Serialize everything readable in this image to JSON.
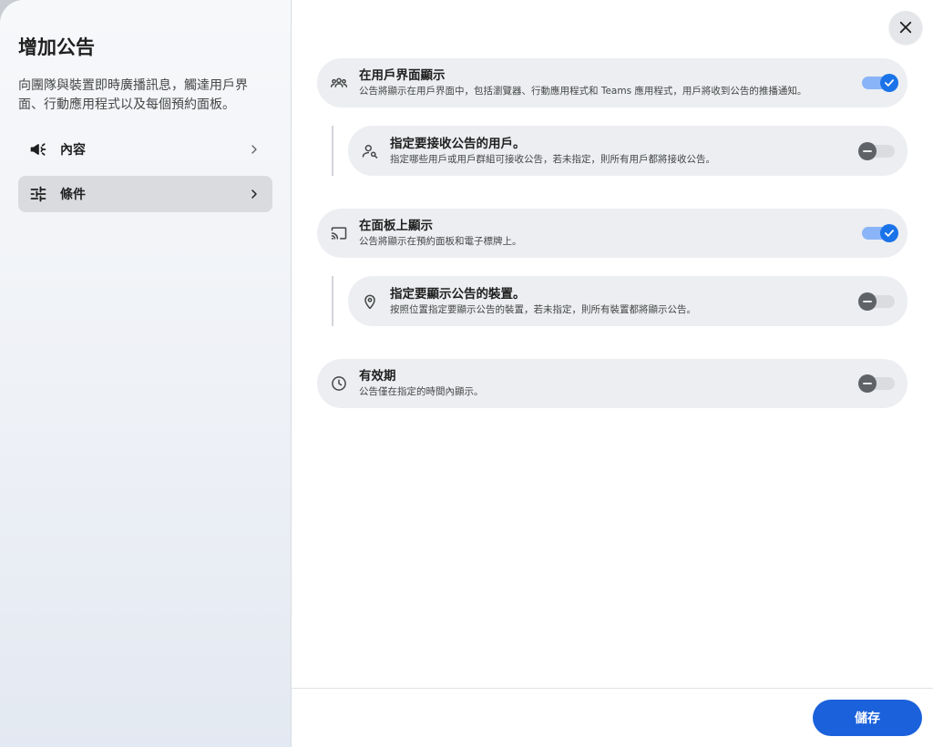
{
  "dialog": {
    "title": "增加公告",
    "description": "向團隊與裝置即時廣播訊息，觸達用戶界面、行動應用程式以及每個預約面板。",
    "nav": [
      {
        "label": "內容",
        "icon": "megaphone-icon"
      },
      {
        "label": "條件",
        "icon": "tune-icon"
      }
    ],
    "active_nav": "條件"
  },
  "conditions": {
    "ui_display": {
      "title": "在用戶界面顯示",
      "desc": "公告將顯示在用戶界面中，包括瀏覽器、行動應用程式和 Teams 應用程式，用戶將收到公告的推播通知。",
      "enabled": true,
      "icon": "group-icon"
    },
    "recipients": {
      "title": "指定要接收公告的用戶。",
      "desc": "指定哪些用戶或用戶群組可接收公告，若未指定，則所有用戶都將接收公告。",
      "enabled": false,
      "icon": "person-search-icon"
    },
    "panel_display": {
      "title": "在面板上顯示",
      "desc": "公告將顯示在預約面板和電子標牌上。",
      "enabled": true,
      "icon": "cast-icon"
    },
    "devices": {
      "title": "指定要顯示公告的裝置。",
      "desc": "按照位置指定要顯示公告的裝置，若未指定，則所有裝置都將顯示公告。",
      "enabled": false,
      "icon": "location-pin-icon"
    },
    "validity": {
      "title": "有效期",
      "desc": "公告僅在指定的時間內顯示。",
      "enabled": false,
      "icon": "clock-icon"
    }
  },
  "footer": {
    "save_label": "儲存"
  },
  "colors": {
    "primary": "#1a61db",
    "toggle_on": "#1a73e8",
    "row_bg": "#eceef1"
  }
}
